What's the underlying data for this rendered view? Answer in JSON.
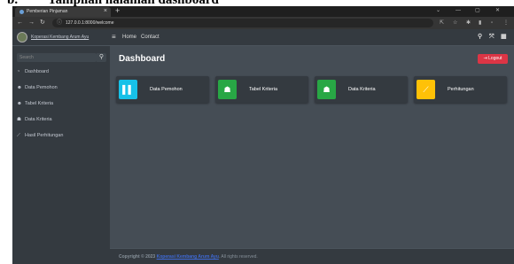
{
  "doc_heading": {
    "number": "b.",
    "text": "Tampilan halaman dashboard"
  },
  "browser": {
    "tab_title": "Pemberian Pinjaman",
    "url": "127.0.0.1:8000/welcome"
  },
  "navbar": {
    "brand": "Koperasi Kembang Arum Ayu",
    "links": [
      "Home",
      "Contact"
    ]
  },
  "sidebar": {
    "search_placeholder": "Search",
    "items": [
      {
        "label": "Dashboard",
        "icon": "dashboard-icon"
      },
      {
        "label": "Data Pemohon",
        "icon": "user-circle-icon"
      },
      {
        "label": "Tabel Kriteria",
        "icon": "user-circle-icon"
      },
      {
        "label": "Data Kriteria",
        "icon": "users-icon"
      },
      {
        "label": "Hasil Perhitungan",
        "icon": "chart-line-icon"
      }
    ]
  },
  "main": {
    "title": "Dashboard",
    "logout_label": "Logout",
    "cards": [
      {
        "label": "Data Pemohon",
        "color": "#17c1e8",
        "icon": "book-icon"
      },
      {
        "label": "Tabel Kriteria",
        "color": "#28a745",
        "icon": "users-icon"
      },
      {
        "label": "Data Kriteria",
        "color": "#28a745",
        "icon": "users-icon"
      },
      {
        "label": "Perhitungan",
        "color": "#ffc107",
        "icon": "chart-line-icon"
      }
    ]
  },
  "footer": {
    "prefix": "Copyright © 2023",
    "org": "Koperasi Kembang Arum Ayu",
    "suffix": ". All rights reserved."
  }
}
